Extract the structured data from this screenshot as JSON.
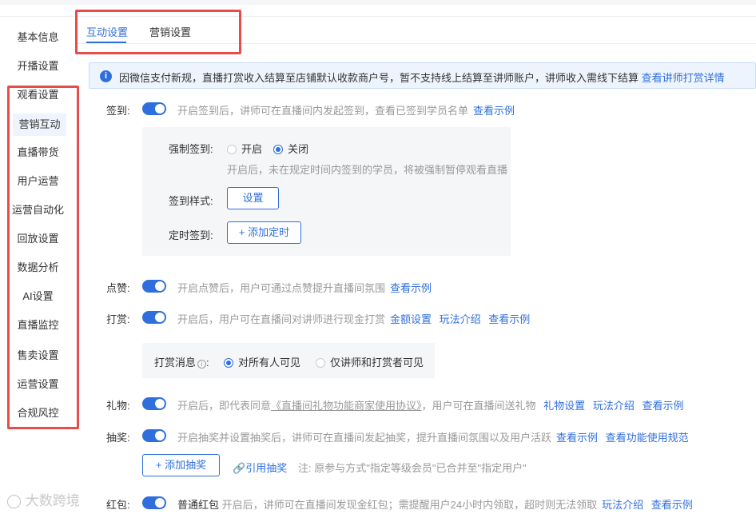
{
  "sidebar": {
    "items": [
      {
        "label": "基本信息"
      },
      {
        "label": "开播设置"
      },
      {
        "label": "观看设置"
      },
      {
        "label": "营销互动"
      },
      {
        "label": "直播带货"
      },
      {
        "label": "用户运营"
      },
      {
        "label": "运营自动化"
      },
      {
        "label": "回放设置"
      },
      {
        "label": "数据分析"
      },
      {
        "label": "AI设置"
      },
      {
        "label": "直播监控"
      },
      {
        "label": "售卖设置"
      },
      {
        "label": "运营设置"
      },
      {
        "label": "合规风控"
      }
    ],
    "active_index": 3
  },
  "tabs": [
    {
      "label": "互动设置"
    },
    {
      "label": "营销设置"
    }
  ],
  "notice": {
    "text": "因微信支付新规，直播打赏收入结算至店铺默认收款商户号，暂不支持线上结算至讲师账户，讲师收入需线下结算",
    "link": "查看讲师打赏详情"
  },
  "signin": {
    "label": "签到:",
    "enabled": true,
    "desc": "开启签到后，讲师可在直播间内发起签到，查看已签到学员名单",
    "link": "查看示例",
    "force_label": "强制签到:",
    "force_options": [
      "开启",
      "关闭"
    ],
    "force_selected": "关闭",
    "force_hint": "开启后，未在规定时间内签到的学员，将被强制暂停观看直播",
    "style_label": "签到样式:",
    "style_button": "设置",
    "timer_label": "定时签到:",
    "timer_button": "+ 添加定时"
  },
  "like": {
    "label": "点赞:",
    "enabled": true,
    "desc": "开启点赞后，用户可通过点赞提升直播间氛围",
    "link": "查看示例"
  },
  "reward": {
    "label": "打赏:",
    "enabled": true,
    "desc": "开启后，用户可在直播间对讲师进行现金打赏",
    "links": [
      "金额设置",
      "玩法介绍",
      "查看示例"
    ],
    "message_label": "打赏消息",
    "message_options": [
      "对所有人可见",
      "仅讲师和打赏者可见"
    ],
    "message_selected": "对所有人可见"
  },
  "gift": {
    "label": "礼物:",
    "enabled": true,
    "desc_prefix": "开启后，即代表同意",
    "agreement": "《直播间礼物功能商家使用协议》",
    "desc_suffix": "，用户可在直播间送礼物",
    "links": [
      "礼物设置",
      "玩法介绍",
      "查看示例"
    ]
  },
  "lottery": {
    "label": "抽奖:",
    "enabled": true,
    "desc": "开启抽奖并设置抽奖后，讲师可在直播间发起抽奖，提升直播间氛围以及用户活跃",
    "links": [
      "查看示例",
      "查看功能使用规范"
    ],
    "add_button": "+ 添加抽奖",
    "ref_link": "引用抽奖",
    "note": "注: 原参与方式\"指定等级会员\"已合并至\"指定用户\""
  },
  "redpacket": {
    "label": "红包:",
    "enabled": true,
    "type": "普通红包",
    "desc": "开启后，讲师可在直播间发现金红包；需提醒用户24小时内领取，超时则无法领取",
    "links": [
      "玩法介绍",
      "查看示例"
    ]
  },
  "watermark": "大数跨境",
  "colors": {
    "accent": "#2f6fdd",
    "highlight_box": "#e94b4b",
    "notice_bg": "#eef4fe"
  }
}
